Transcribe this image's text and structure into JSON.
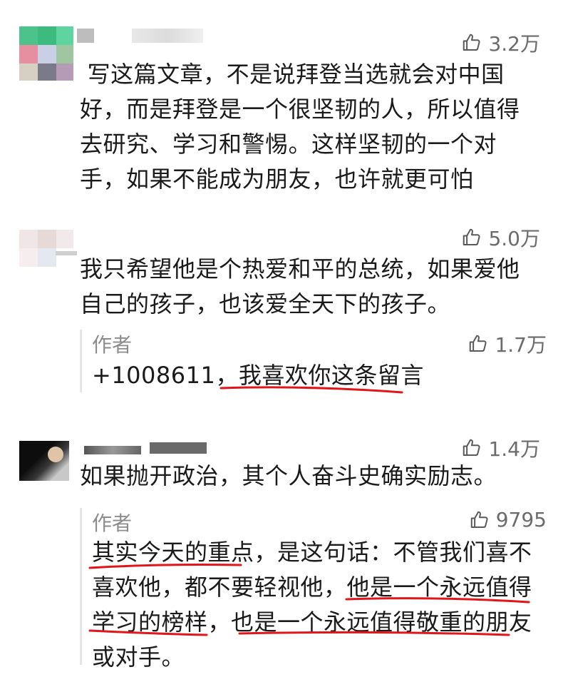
{
  "colors": {
    "text": "#1a1a1a",
    "secondary": "#8c8c8c",
    "like": "#6b6b6b",
    "annotation": "#e0161b"
  },
  "comments": [
    {
      "likes": "3.2万",
      "text": " 写这篇文章，不是说拜登当选就会对中国\n好，而是拜登是一个很坚韧的人，所以值得\n去研究、学习和警惕。这样坚韧的一个对\n手，如果不能成为朋友，也许就更可怕"
    },
    {
      "likes": "5.0万",
      "text": "我只希望他是个热爱和平的总统，如果爱他\n自己的孩子，也该爱全天下的孩子。",
      "reply": {
        "author": "作者",
        "likes": "1.7万",
        "text": "+1008611，我喜欢你这条留言"
      }
    },
    {
      "likes": "1.4万",
      "text": "如果抛开政治，其个人奋斗史确实励志。",
      "reply": {
        "author": "作者",
        "likes": "9795",
        "text": "其实今天的重点，是这句话：不管我们喜不\n喜欢他，都不要轻视他，他是一个永远值得\n学习的榜样，也是一个永远值得敬重的朋友\n或对手。"
      }
    }
  ],
  "icons": {
    "like": "thumbs-up-icon"
  }
}
